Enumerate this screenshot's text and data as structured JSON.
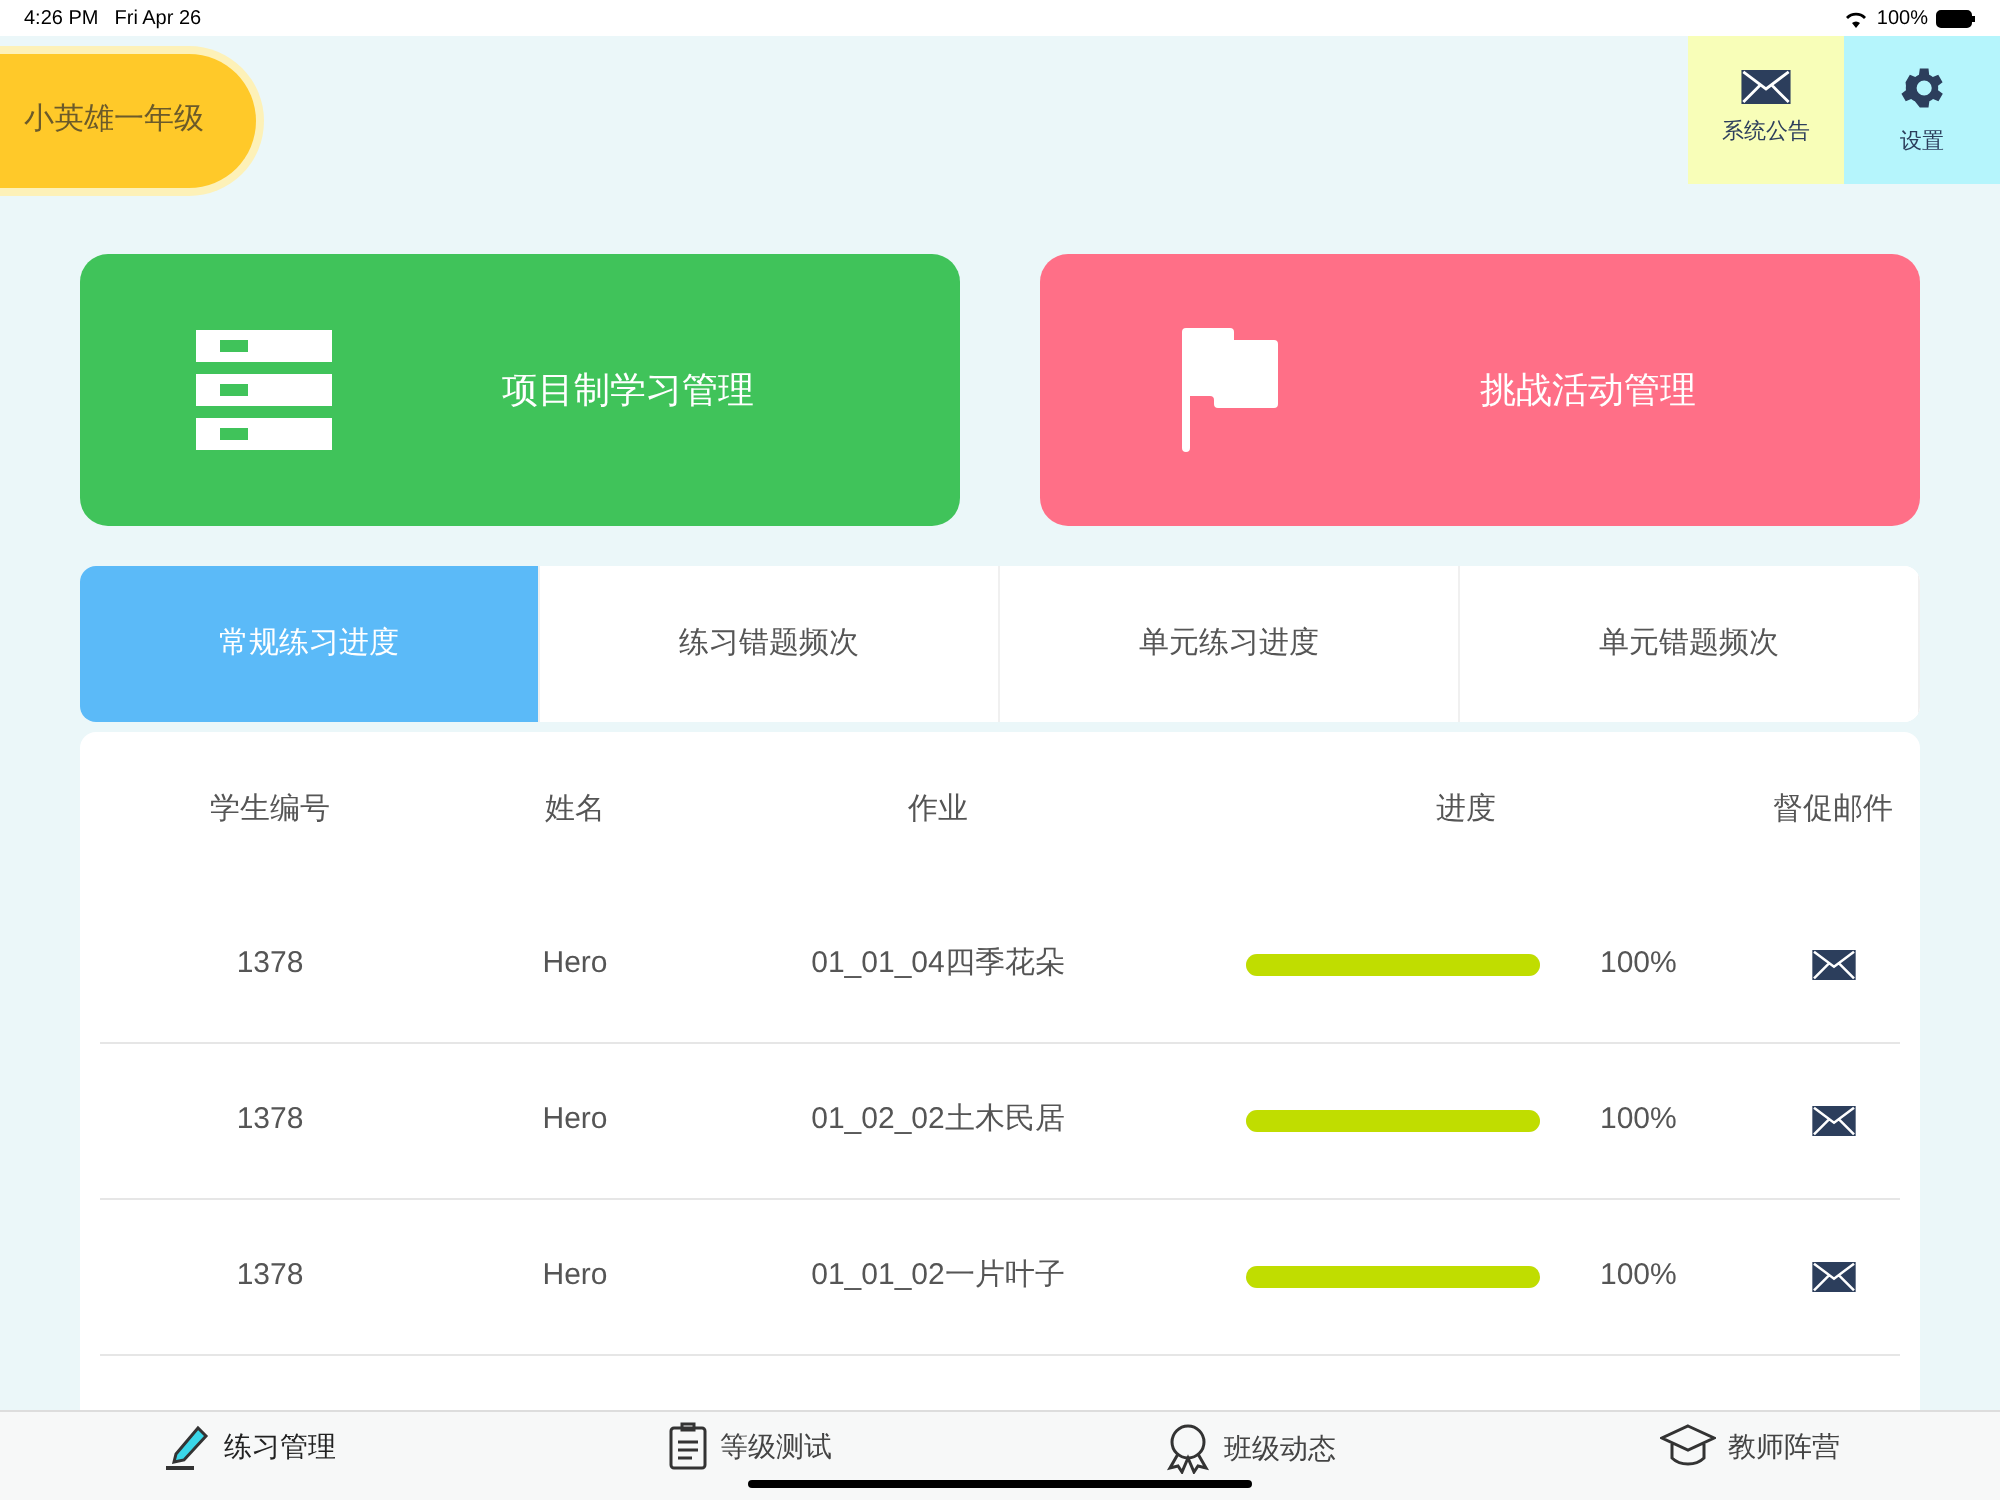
{
  "status_bar": {
    "time": "4:26 PM",
    "date": "Fri Apr 26",
    "battery": "100%"
  },
  "header": {
    "class_name": "小英雄一年级",
    "buttons": [
      {
        "kind": "mail",
        "label": "系统公告"
      },
      {
        "kind": "settings",
        "label": "设置"
      }
    ]
  },
  "cards": [
    {
      "kind": "list",
      "label": "项目制学习管理"
    },
    {
      "kind": "flag",
      "label": "挑战活动管理"
    }
  ],
  "tabs": [
    {
      "label": "常规练习进度",
      "selected": true
    },
    {
      "label": "练习错题频次",
      "selected": false
    },
    {
      "label": "单元练习进度",
      "selected": false
    },
    {
      "label": "单元错题频次",
      "selected": false
    }
  ],
  "table": {
    "columns": [
      "学生编号",
      "姓名",
      "作业",
      "进度",
      "督促邮件"
    ],
    "rows": [
      {
        "id": "1378",
        "name": "Hero",
        "assignment": "01_01_04四季花朵",
        "level": 1,
        "reading": "100%"
      },
      {
        "id": "1378",
        "name": "Hero",
        "assignment": "01_02_02土木民居",
        "level": 1,
        "reading": "100%"
      },
      {
        "id": "1378",
        "name": "Hero",
        "assignment": "01_01_02一片叶子",
        "level": 1,
        "reading": "100%"
      }
    ]
  },
  "bottom_nav": [
    {
      "kind": "pencil",
      "label": "练习管理",
      "selected": true
    },
    {
      "kind": "clipboard",
      "label": "等级测试",
      "selected": false
    },
    {
      "kind": "medal",
      "label": "班级动态",
      "selected": false
    },
    {
      "kind": "cap",
      "label": "教师阵营",
      "selected": false
    }
  ]
}
